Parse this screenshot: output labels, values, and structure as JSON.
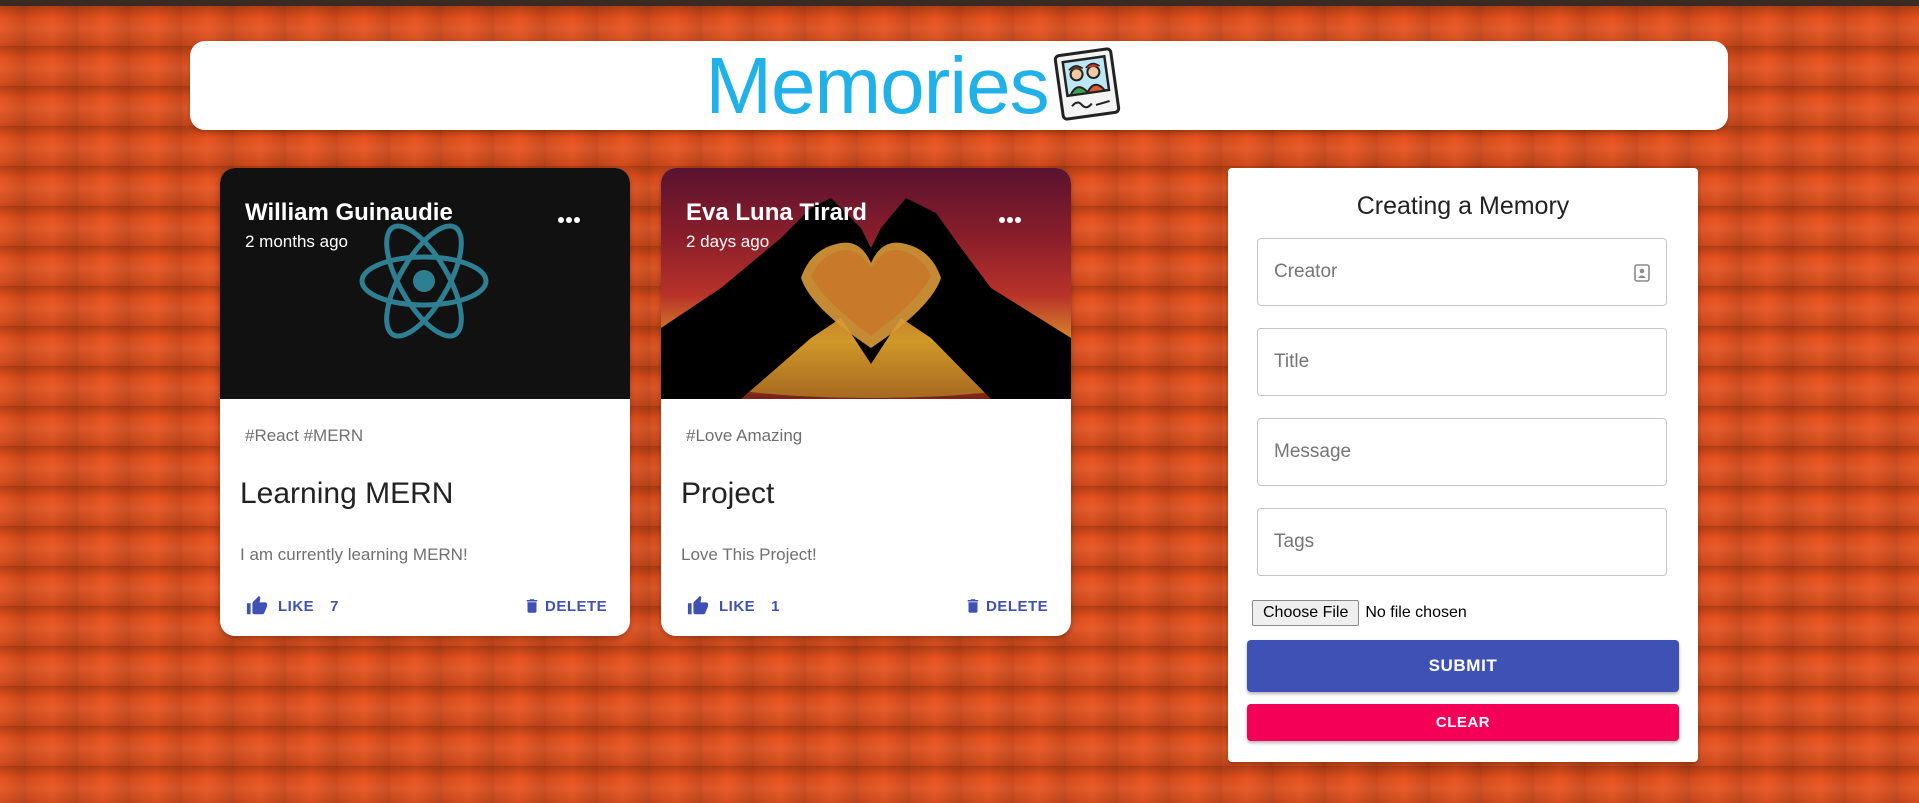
{
  "app": {
    "title": "Memories",
    "logo_icon": "memories-photo-icon",
    "title_color": "#1fb1e8",
    "background_color": "#e8521e"
  },
  "posts": [
    {
      "creator": "William Guinaudie",
      "time_ago": "2 months ago",
      "tags": "#React #MERN",
      "title": "Learning MERN",
      "message": "I am currently learning MERN!",
      "like_label": "LIKE",
      "like_count": "7",
      "delete_label": "DELETE",
      "media_icon": "react-atom-icon"
    },
    {
      "creator": "Eva Luna Tirard",
      "time_ago": "2 days ago",
      "tags": "#Love Amazing",
      "title": "Project",
      "message": "Love This Project!",
      "like_label": "LIKE",
      "like_count": "1",
      "delete_label": "DELETE",
      "media_icon": "heart-hands-sunset-icon"
    }
  ],
  "form": {
    "heading": "Creating a Memory",
    "creator_placeholder": "Creator",
    "title_placeholder": "Title",
    "message_placeholder": "Message",
    "tags_placeholder": "Tags",
    "file_button": "Choose File",
    "file_status": "No file chosen",
    "submit_label": "SUBMIT",
    "clear_label": "CLEAR",
    "primary_color": "#3f51b5",
    "secondary_color": "#f50057"
  }
}
